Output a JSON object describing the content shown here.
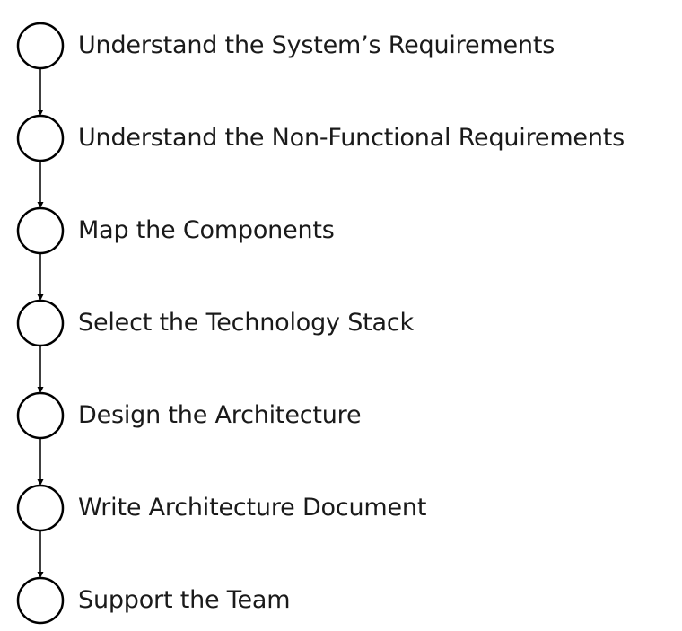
{
  "steps": [
    {
      "label": "Understand the System’s Requirements"
    },
    {
      "label": "Understand the Non-Functional Requirements"
    },
    {
      "label": "Map the Components"
    },
    {
      "label": "Select the Technology Stack"
    },
    {
      "label": "Design the Architecture"
    },
    {
      "label": "Write Architecture Document"
    },
    {
      "label": "Support the Team"
    }
  ],
  "colors": {
    "stroke": "#000000",
    "text": "#1a1a1a",
    "background": "#ffffff"
  }
}
